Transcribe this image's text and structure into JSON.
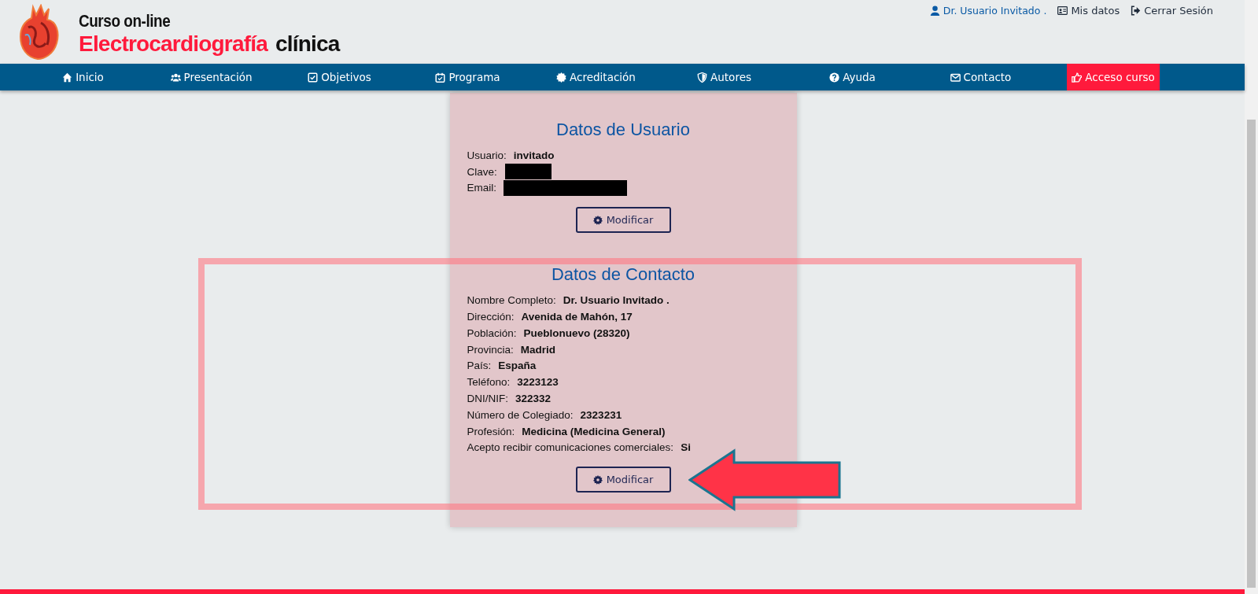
{
  "header": {
    "title_line1": "Curso on-line",
    "title_red": "Electrocardiografía",
    "title_black": "clínica"
  },
  "user_links": [
    {
      "kind": "user",
      "label": "Dr. Usuario Invitado ."
    },
    {
      "kind": "card",
      "label": "Mis datos"
    },
    {
      "kind": "logout",
      "label": "Cerrar Sesión"
    }
  ],
  "nav": [
    {
      "kind": "home",
      "label": "Inicio",
      "selected": false
    },
    {
      "kind": "users",
      "label": "Presentación",
      "selected": false
    },
    {
      "kind": "check",
      "label": "Objetivos",
      "selected": false
    },
    {
      "kind": "calendar",
      "label": "Programa",
      "selected": false
    },
    {
      "kind": "badge",
      "label": "Acreditación",
      "selected": false
    },
    {
      "kind": "shield",
      "label": "Autores",
      "selected": false
    },
    {
      "kind": "question",
      "label": "Ayuda",
      "selected": false
    },
    {
      "kind": "mail",
      "label": "Contacto",
      "selected": false
    },
    {
      "kind": "hand",
      "label": "Acceso curso",
      "selected": true
    }
  ],
  "sections": [
    {
      "title": "Datos de Usuario",
      "fields": [
        {
          "label": "Usuario:",
          "value": "invitado",
          "redacted": false
        },
        {
          "label": "Clave:",
          "redacted": true
        },
        {
          "label": "Email:",
          "redacted": true
        }
      ],
      "button": "Modificar"
    },
    {
      "title": "Datos de Contacto",
      "fields": [
        {
          "label": "Nombre Completo:",
          "value": "Dr. Usuario Invitado .",
          "redacted": false
        },
        {
          "label": "Dirección:",
          "value": "Avenida de Mahón, 17",
          "redacted": false
        },
        {
          "label": "Población:",
          "value": "Pueblonuevo (28320)",
          "redacted": false
        },
        {
          "label": "Provincia:",
          "value": "Madrid",
          "redacted": false
        },
        {
          "label": "País:",
          "value": "España",
          "redacted": false
        },
        {
          "label": "Teléfono:",
          "value": "3223123",
          "redacted": false
        },
        {
          "label": "DNI/NIF:",
          "value": "322332",
          "redacted": false
        },
        {
          "label": "Número de Colegiado:",
          "value": "2323231",
          "redacted": false
        },
        {
          "label": "Profesión:",
          "value": "Medicina (Medicina General)",
          "redacted": false
        },
        {
          "label": "Acepto recibir comunicaciones comerciales:",
          "value": "Si",
          "redacted": false
        }
      ],
      "button": "Modificar",
      "highlighted": true
    }
  ]
}
